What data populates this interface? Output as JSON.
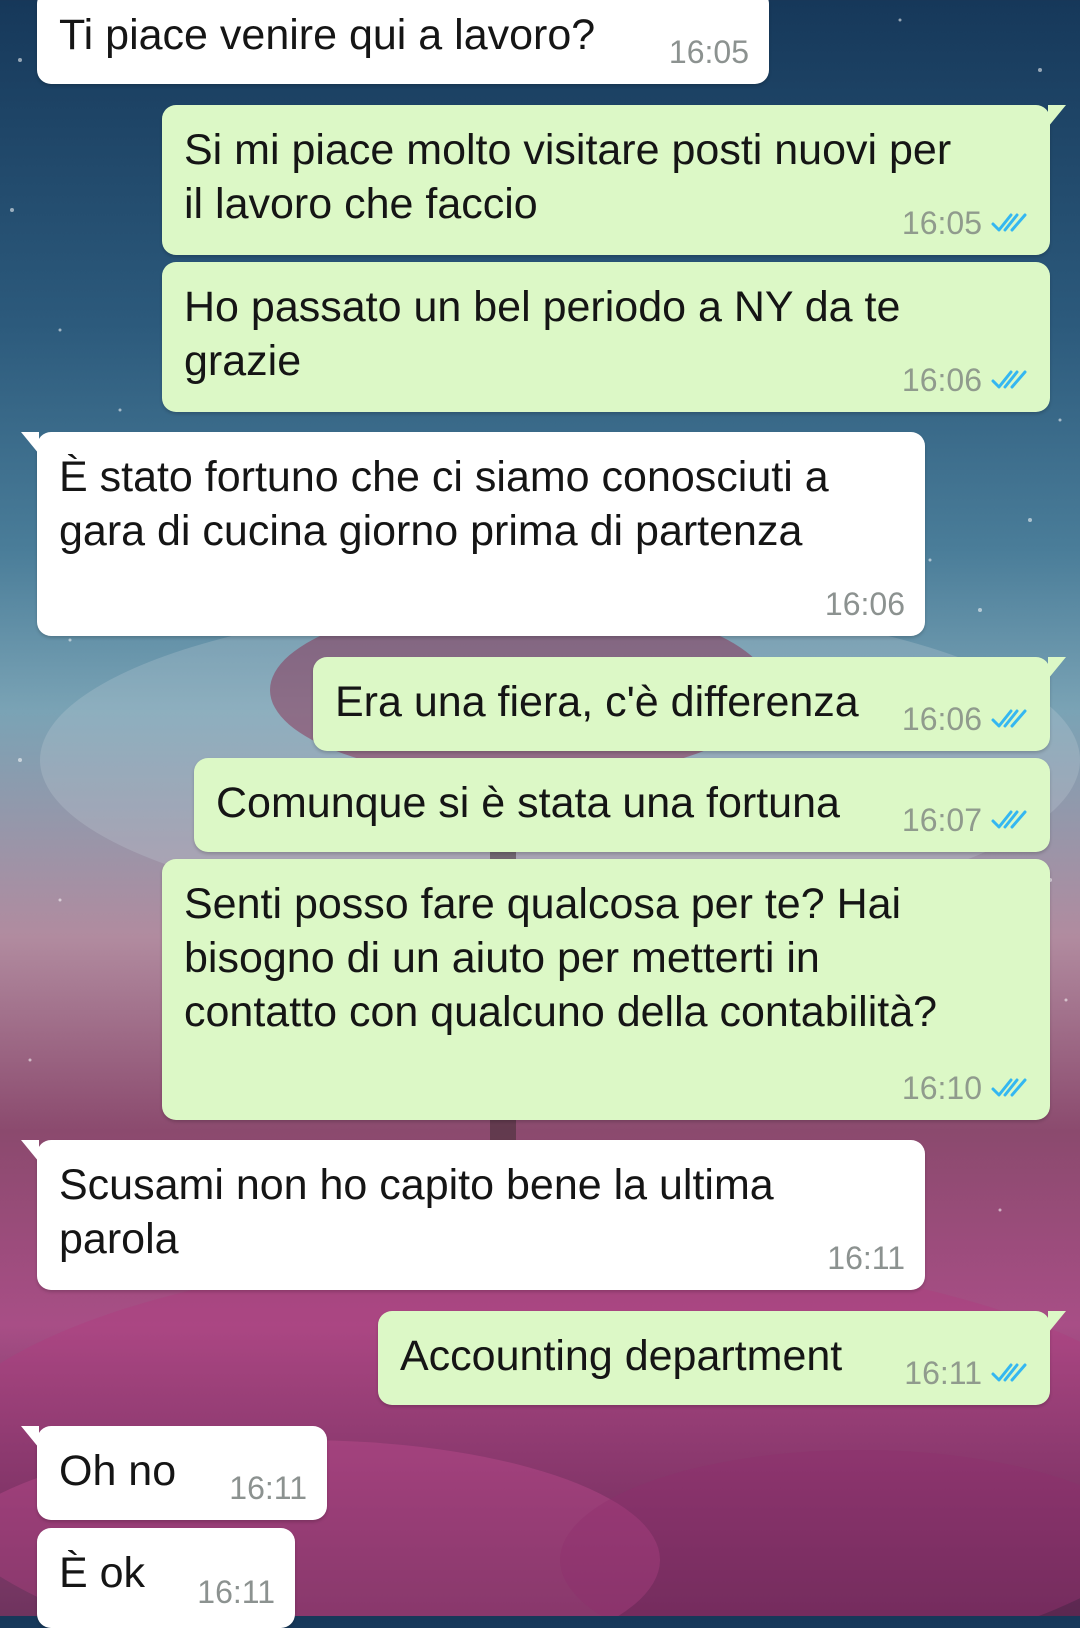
{
  "messages": [
    {
      "direction": "in",
      "text": "Ti piace venire qui a lavoro?",
      "time": "16:05"
    },
    {
      "direction": "out",
      "text": "Si mi piace molto visitare posti nuovi per\nil lavoro che faccio",
      "time": "16:05",
      "status": "read"
    },
    {
      "direction": "out",
      "text": "Ho passato un bel periodo a NY da te\ngrazie",
      "time": "16:06",
      "status": "read"
    },
    {
      "direction": "in",
      "text": "È stato fortuno che ci siamo conosciuti a\ngara di cucina giorno prima di partenza",
      "time": "16:06"
    },
    {
      "direction": "out",
      "text": "Era una fiera, c'è differenza",
      "time": "16:06",
      "status": "read"
    },
    {
      "direction": "out",
      "text": "Comunque si è stata una fortuna",
      "time": "16:07",
      "status": "read"
    },
    {
      "direction": "out",
      "text": "Senti posso fare qualcosa per te? Hai\nbisogno di un aiuto per metterti in\ncontatto con qualcuno della contabilità?",
      "time": "16:10",
      "status": "read"
    },
    {
      "direction": "in",
      "text": "Scusami non ho capito bene la ultima\nparola",
      "time": "16:11"
    },
    {
      "direction": "out",
      "text": "Accounting department",
      "time": "16:11",
      "status": "read"
    },
    {
      "direction": "in",
      "text": "Oh no",
      "time": "16:11"
    },
    {
      "direction": "in",
      "text": "È ok",
      "time": "16:11"
    }
  ],
  "colors": {
    "incoming_bubble": "#ffffff",
    "outgoing_bubble": "#dcf8c6",
    "read_ticks": "#34b7f1",
    "timestamp": "#8c9290"
  },
  "icons": {
    "read_receipt": "double-check-icon"
  }
}
